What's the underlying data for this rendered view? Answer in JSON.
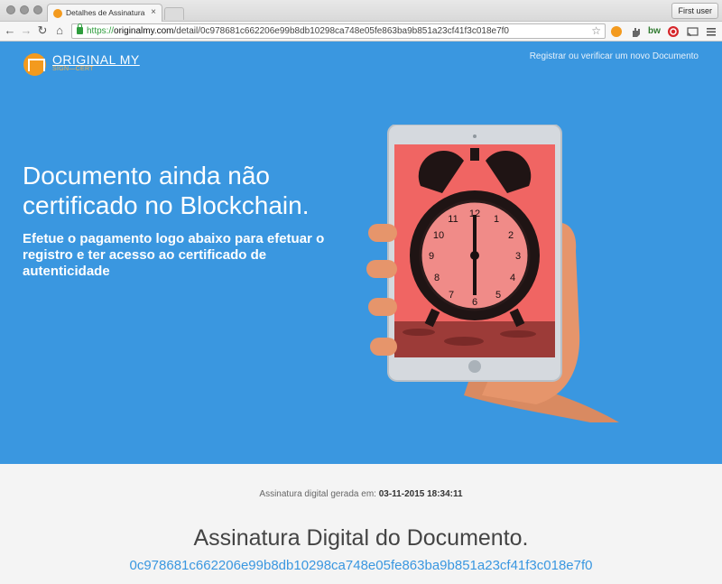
{
  "browser": {
    "tab_title": "Detalhes de Assinatura e C",
    "tab_close": "×",
    "user_button": "First user",
    "url_protocol": "https://",
    "url_host": "originalmy.com",
    "url_path": "/detail/0c978681c662206e99b8db10298ca748e05fe863ba9b851a23cf41f3c018e7f0",
    "extensions": [
      "orange-extension-icon",
      "hand-extension-icon",
      "bw-extension-icon",
      "red-extension-icon",
      "cast-icon",
      "menu-icon"
    ],
    "bw_label": "bw"
  },
  "header": {
    "logo_name": "ORIGINAL MY",
    "logo_sub": "SIGN—CERT",
    "top_link": "Registrar ou verificar um novo Documento"
  },
  "hero": {
    "title": "Documento ainda não certificado no Blockchain.",
    "subtitle": "Efetue o pagamento logo abaixo para efetuar o registro e ter acesso ao certificado de autenticidade"
  },
  "signature": {
    "generated_label": "Assinatura digital gerada em:",
    "generated_value": "03-11-2015 18:34:11",
    "title": "Assinatura Digital do Documento.",
    "hash": "0c978681c662206e99b8db10298ca748e05fe863ba9b851a23cf41f3c018e7f0"
  },
  "colors": {
    "hero_bg": "#3a97e0",
    "accent_orange": "#f39a1e",
    "screen_red": "#f06563",
    "hash_link": "#3a97e0"
  }
}
